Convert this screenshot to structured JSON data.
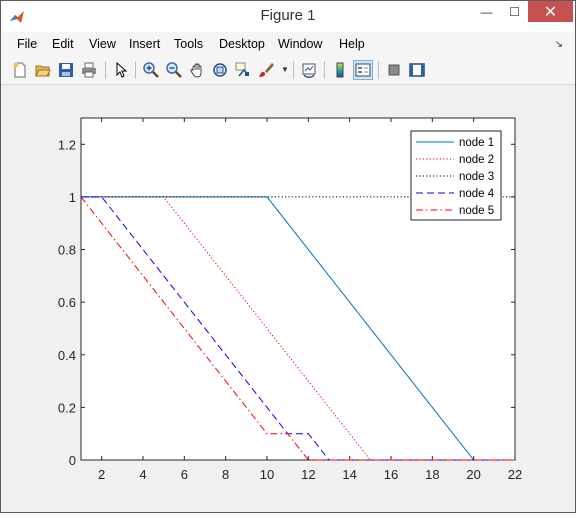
{
  "window": {
    "title": "Figure 1",
    "minimize_glyph": "—",
    "maximize_glyph": "☐",
    "close_glyph": "✕"
  },
  "menu": {
    "items": [
      "File",
      "Edit",
      "View",
      "Insert",
      "Tools",
      "Desktop",
      "Window",
      "Help"
    ],
    "dock_arrow": "↘"
  },
  "toolbar": {
    "buttons": [
      "new-figure-icon",
      "open-file-icon",
      "save-icon",
      "print-icon",
      "edit-plot-icon",
      "zoom-in-icon",
      "zoom-out-icon",
      "pan-icon",
      "rotate-3d-icon",
      "data-cursor-icon",
      "brush-icon",
      "link-plot-icon",
      "colorbar-icon",
      "legend-icon",
      "hide-plot-tools-icon",
      "show-plot-tools-icon"
    ],
    "active": [
      "legend-icon"
    ]
  },
  "chart_data": {
    "type": "line",
    "title": "",
    "xlabel": "",
    "ylabel": "",
    "xlim": [
      1,
      22
    ],
    "ylim": [
      0,
      1.3
    ],
    "xticks": [
      2,
      4,
      6,
      8,
      10,
      12,
      14,
      16,
      18,
      20,
      22
    ],
    "yticks": [
      0,
      0.2,
      0.4,
      0.6,
      0.8,
      1,
      1.2
    ],
    "grid": false,
    "legend_position": "top-right",
    "series": [
      {
        "name": "node 1",
        "color": "#0072bd",
        "style": "solid",
        "x": [
          1,
          10,
          20,
          22
        ],
        "y": [
          1,
          1,
          0,
          0
        ]
      },
      {
        "name": "node 2",
        "color": "#ff0000",
        "style": "dotted",
        "x": [
          1,
          5,
          15,
          22
        ],
        "y": [
          1,
          1,
          0,
          0
        ]
      },
      {
        "name": "node 3",
        "color": "#000000",
        "style": "dotted",
        "x": [
          1,
          22
        ],
        "y": [
          1,
          1
        ]
      },
      {
        "name": "node 4",
        "color": "#0000ff",
        "style": "dashed",
        "x": [
          1,
          2,
          10,
          11,
          12,
          13,
          22
        ],
        "y": [
          1,
          1,
          0.2,
          0.1,
          0.1,
          0,
          0
        ]
      },
      {
        "name": "node 5",
        "color": "#ff0000",
        "style": "dashdot",
        "x": [
          1,
          10,
          11,
          12,
          22
        ],
        "y": [
          1,
          0.1,
          0.1,
          0,
          0
        ]
      }
    ]
  }
}
